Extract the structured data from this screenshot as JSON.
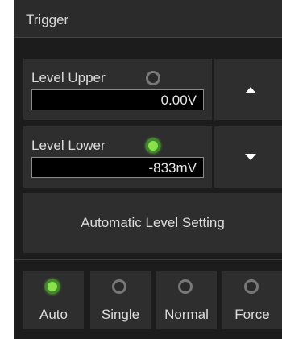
{
  "panel": {
    "title": "Trigger"
  },
  "level_upper": {
    "label": "Level Upper",
    "value": "0.00V",
    "indicator_on": false
  },
  "level_lower": {
    "label": "Level Lower",
    "value": "-833mV",
    "indicator_on": true
  },
  "buttons": {
    "up_icon": "triangle-up-icon",
    "down_icon": "triangle-down-icon",
    "auto_level": "Automatic Level Setting"
  },
  "modes": [
    {
      "label": "Auto",
      "active": true
    },
    {
      "label": "Single",
      "active": false
    },
    {
      "label": "Normal",
      "active": false
    },
    {
      "label": "Force",
      "active": false
    }
  ],
  "colors": {
    "indicator_on": "#8be04e",
    "indicator_off": "#787878",
    "background": "#1c1c1c"
  }
}
